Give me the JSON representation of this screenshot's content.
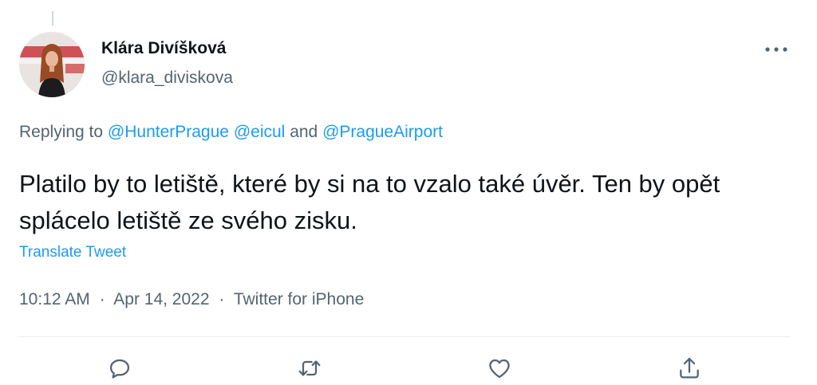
{
  "tweet": {
    "author": {
      "display_name": "Klára Divíšková",
      "handle": "@klara_diviskova",
      "avatar_icon": "avatar-photo"
    },
    "replying_to": {
      "prefix": "Replying to",
      "mentions": [
        "@HunterPrague",
        "@eicul",
        "@PragueAirport"
      ],
      "connector": "and"
    },
    "text": "Platilo by to letiště, které by si na to vzalo také úvěr. Ten by opět splácelo letiště ze svého zisku.",
    "translate_label": "Translate Tweet",
    "time": "10:12 AM",
    "date": "Apr 14, 2022",
    "source": "Twitter for iPhone",
    "separator": "·"
  },
  "actions": [
    {
      "name": "reply",
      "icon": "reply-icon"
    },
    {
      "name": "retweet",
      "icon": "retweet-icon"
    },
    {
      "name": "like",
      "icon": "heart-icon"
    },
    {
      "name": "share",
      "icon": "share-icon"
    }
  ],
  "colors": {
    "accent": "#1d9bf0",
    "secondary_text": "#536471",
    "primary_text": "#0f1419",
    "divider": "#e6ecf0"
  }
}
